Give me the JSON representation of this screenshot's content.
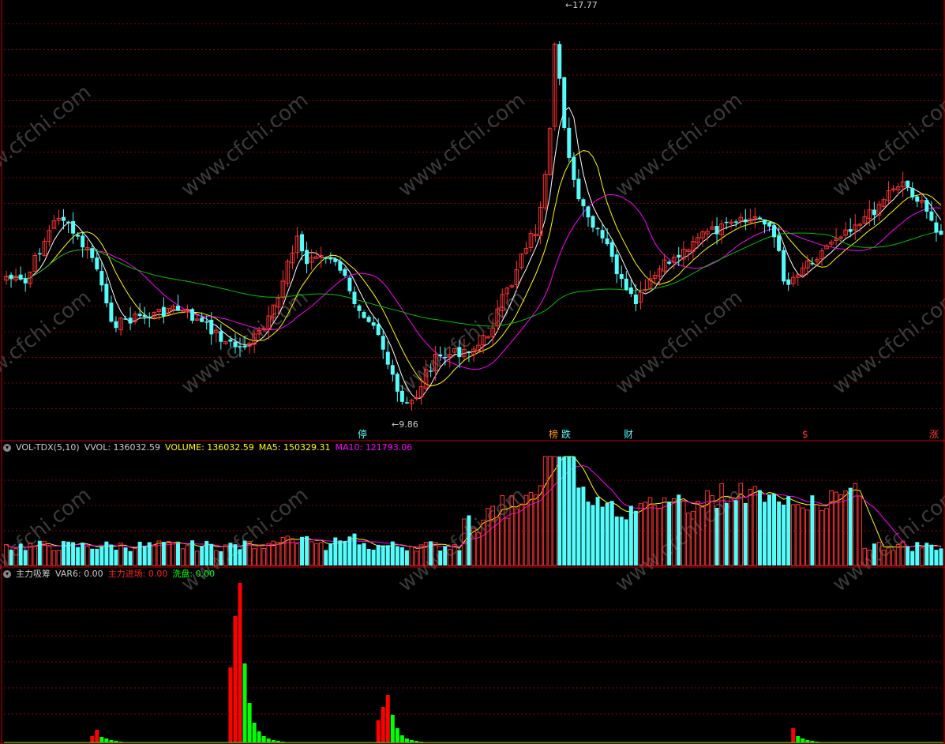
{
  "colors": {
    "background": "#000000",
    "grid": "#8b0000",
    "border": "#c00000",
    "up": "#ff3232",
    "down": "#54fcfc",
    "ma5": "#ffffff",
    "ma10": "#ffff00",
    "ma20": "#ff00ff",
    "ma60": "#00c000",
    "vol_ma5": "#ffff00",
    "vol_ma10": "#ff00ff",
    "main_inflow": "#ff0000",
    "washout": "#00ff00",
    "watermark": "#3a3a3a"
  },
  "price_panel": {
    "high_label": "17.77",
    "low_label": "9.86",
    "watermark": "www.cfchi.com",
    "markers": [
      {
        "text": "停",
        "color": "#54fcfc"
      },
      {
        "text": "榜",
        "color": "#ff9900"
      },
      {
        "text": "跌",
        "color": "#54fcfc"
      },
      {
        "text": "财",
        "color": "#54fcfc"
      },
      {
        "text": "$",
        "color": "#ff3232"
      },
      {
        "text": "涨",
        "color": "#ff3232"
      }
    ]
  },
  "volume_panel": {
    "collapse_icon": "chevron-down-icon",
    "indicator": "VOL-TDX(5,10)",
    "vvol_label": "VVOL: 136032.59",
    "volume_label": "VOLUME: 136032.59",
    "ma5_label": "MA5: 150329.31",
    "ma10_label": "MA10: 121793.06"
  },
  "indicator_panel": {
    "collapse_icon": "chevron-down-icon",
    "name": "主力吸筹",
    "var6_label": "VAR6: 0.00",
    "inflow_label": "主力进场: 0.00",
    "washout_label": "洗盘: 0.00"
  }
}
